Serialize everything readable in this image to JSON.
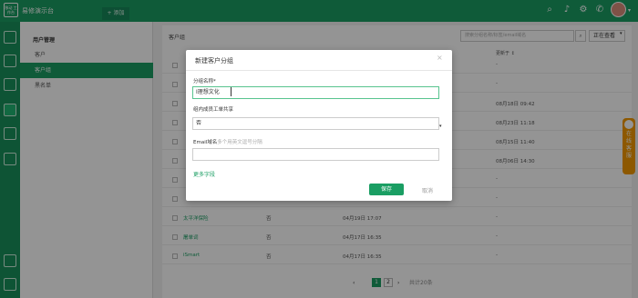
{
  "app": {
    "logo_text": "移动 工作台",
    "title": "易修演示台",
    "add_tab": "+ 添加"
  },
  "subnav": {
    "title": "用户管理",
    "items": [
      {
        "label": "客户"
      },
      {
        "label": "客户组"
      },
      {
        "label": "黑名单"
      }
    ]
  },
  "content": {
    "title": "客户组",
    "search_placeholder": "搜索分组名称/标签/email域名",
    "view_label": "正在查看",
    "columns": {
      "updated": "更新于 ↕"
    },
    "rows": [
      {
        "name": "",
        "shared": "",
        "created": "",
        "updated": "-"
      },
      {
        "name": "",
        "shared": "",
        "created": "",
        "updated": "-"
      },
      {
        "name": "",
        "shared": "",
        "created": "",
        "updated": "08月18日 09:42"
      },
      {
        "name": "",
        "shared": "",
        "created": "",
        "updated": "08月23日 11:18"
      },
      {
        "name": "",
        "shared": "",
        "created": "",
        "updated": "08月15日 11:40"
      },
      {
        "name": "",
        "shared": "",
        "created": "",
        "updated": "08月06日 14:30"
      },
      {
        "name": "",
        "shared": "",
        "created": "",
        "updated": "-"
      },
      {
        "name": "",
        "shared": "",
        "created": "",
        "updated": "-"
      },
      {
        "name": "太平洋保险",
        "shared": "否",
        "created": "04月19日 17:07",
        "updated": "-"
      },
      {
        "name": "屠单词",
        "shared": "否",
        "created": "04月17日 16:35",
        "updated": "-"
      },
      {
        "name": "iSmart",
        "shared": "否",
        "created": "04月17日 16:35",
        "updated": "-"
      }
    ],
    "pagination": {
      "prev": "‹",
      "page1": "1",
      "page2": "2",
      "next": "›",
      "total": "共计20条"
    }
  },
  "modal": {
    "title": "新建客户分组",
    "name_label": "分组名称*",
    "name_value": "I理想文化",
    "share_label": "组内成员工单共享",
    "share_value": "否",
    "email_label": "Email域名",
    "email_hint": "多个用英文逗号分隔",
    "email_value": "",
    "more_fields": "更多字段",
    "save": "保存",
    "cancel": "取消"
  },
  "side_widget": {
    "label": "在线客服"
  },
  "colors": {
    "brand": "#1a9e63",
    "accent": "#f39800"
  }
}
